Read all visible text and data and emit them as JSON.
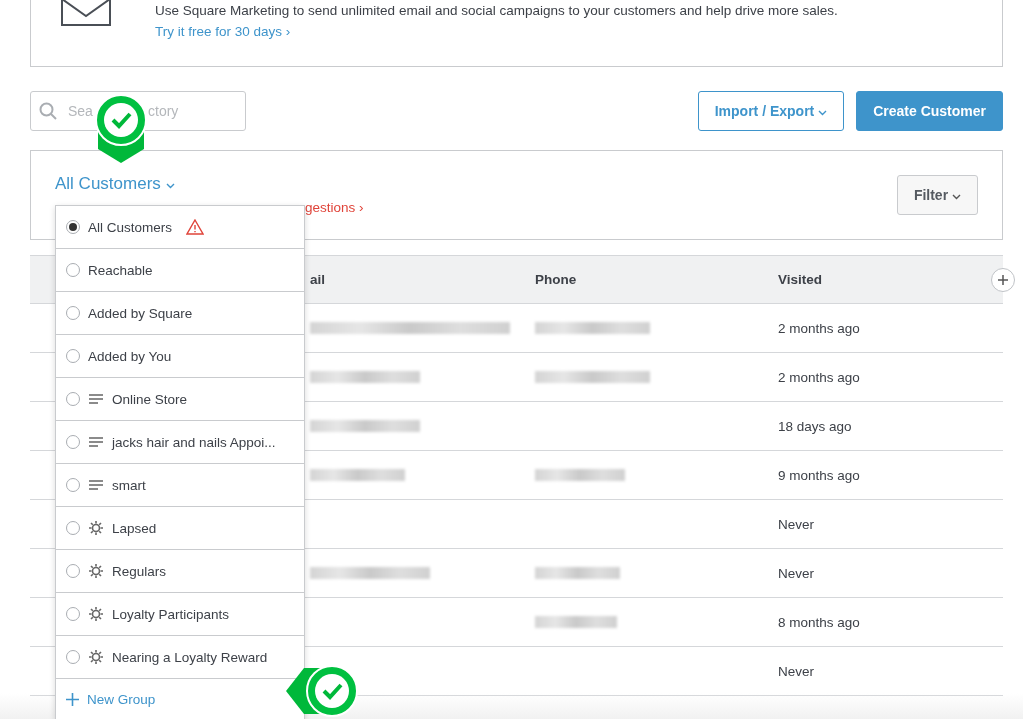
{
  "banner": {
    "text": "Use Square Marketing to send unlimited email and social campaigns to your customers and help drive more sales.",
    "link": "Try it free for 30 days ›"
  },
  "search": {
    "placeholder": "Sea",
    "placeholder_tail": "ctory"
  },
  "buttons": [
    {
      "kind": "outline",
      "label": "Import / Export"
    },
    {
      "kind": "primary",
      "label": "Create Customer"
    }
  ],
  "group_header": {
    "title": "All Customers",
    "duplicates_fragment": "gestions ›",
    "filter": "Filter"
  },
  "table": {
    "columns": [
      "ail",
      "Phone",
      "Visited"
    ],
    "rows": [
      {
        "email_hidden": true,
        "phone_hidden": true,
        "visited": "2 months ago"
      },
      {
        "email_hidden": true,
        "phone_hidden": true,
        "visited": "2 months ago"
      },
      {
        "email_hidden": true,
        "phone_hidden": false,
        "visited": "18 days ago"
      },
      {
        "email_hidden": true,
        "phone_hidden": true,
        "visited": "9 months ago"
      },
      {
        "email_hidden": false,
        "phone_hidden": false,
        "visited": "Never"
      },
      {
        "email_hidden": true,
        "phone_hidden": true,
        "visited": "Never"
      },
      {
        "email_hidden": false,
        "phone_hidden": true,
        "visited": "8 months ago"
      },
      {
        "email_hidden": false,
        "phone_hidden": false,
        "visited": "Never"
      }
    ]
  },
  "dropdown": {
    "items": [
      {
        "kind": "plain",
        "label": "All Customers",
        "selected": true,
        "warning": true
      },
      {
        "kind": "plain",
        "label": "Reachable",
        "selected": false,
        "warning": false
      },
      {
        "kind": "plain",
        "label": "Added by Square",
        "selected": false,
        "warning": false
      },
      {
        "kind": "plain",
        "label": "Added by You",
        "selected": false,
        "warning": false
      },
      {
        "kind": "list",
        "label": "Online Store",
        "selected": false,
        "warning": false
      },
      {
        "kind": "list",
        "label": "jacks hair and nails Appoi...",
        "selected": false,
        "warning": false
      },
      {
        "kind": "list",
        "label": "smart",
        "selected": false,
        "warning": false
      },
      {
        "kind": "auto",
        "label": "Lapsed",
        "selected": false,
        "warning": false
      },
      {
        "kind": "auto",
        "label": "Regulars",
        "selected": false,
        "warning": false
      },
      {
        "kind": "auto",
        "label": "Loyalty Participants",
        "selected": false,
        "warning": false
      },
      {
        "kind": "auto",
        "label": "Nearing a Loyalty Reward",
        "selected": false,
        "warning": false
      }
    ],
    "new_group": "New Group"
  }
}
